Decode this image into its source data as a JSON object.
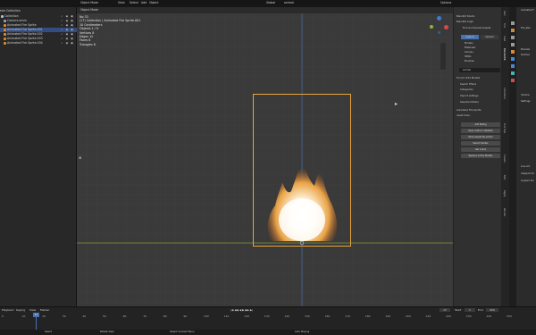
{
  "topbar": {
    "menu": [
      "Object Mode",
      "View",
      "Select",
      "Add",
      "Object"
    ],
    "viewport_menu": [
      "Global",
      "animal"
    ],
    "options": "Options"
  },
  "outliner": {
    "title": "ene Collection",
    "rows": [
      {
        "label": "Collection",
        "indent": 0,
        "selected": false
      },
      {
        "label": "Camera.amm",
        "indent": 1,
        "selected": false
      },
      {
        "label": "Animated Fire Sprite",
        "indent": 1,
        "selected": false
      },
      {
        "label": "Animated Fire Sprite.001",
        "indent": 1,
        "selected": true
      },
      {
        "label": "Animated Fire Sprite.002",
        "indent": 1,
        "selected": false
      },
      {
        "label": "Animated Fire Sprite.003",
        "indent": 1,
        "selected": false
      },
      {
        "label": "Animated Fire Sprite.004",
        "indent": 1,
        "selected": false
      }
    ]
  },
  "viewport": {
    "header_left": "Object Mode",
    "stats": [
      "No 33",
      "(17) Collection | Animated Fire Sprite.001",
      "10 Centimeters",
      "",
      "Objects   1 / 9",
      "Vertices   8",
      "Edges   12",
      "Faces   6",
      "Triangles   8"
    ]
  },
  "side_panel": {
    "header": "Blendkit Studio",
    "items": [
      "Blendkit Studio",
      "Blendkit Login",
      "Find and Upload Assets"
    ],
    "tabs": [
      "Search",
      "Upload"
    ],
    "categories": [
      "Models",
      "Materials",
      "Scenes",
      "HDRs",
      "Brushes"
    ],
    "search_value": "animal",
    "found": "Found 1234 Models",
    "sections": [
      "Search Filters",
      "Categories",
      "Import settings",
      "Selected Model"
    ],
    "model_name": "Animated Fire Sprite",
    "asset_tools": "Asset tools:",
    "buttons": [
      "Add Rating",
      "Open Author's Website",
      "Show Assets By Author",
      "Search Similar",
      "Get online",
      "Replace Active Models"
    ]
  },
  "vertical_tabs": [
    "Item",
    "Tool",
    "View",
    "BlenderKit",
    "Animation",
    "Tool Tips",
    "Create",
    "Edit",
    "Rigify",
    "Render"
  ],
  "properties": {
    "title": "Animated F",
    "sub": "Fire_Ren",
    "rows": [
      "Preview",
      "Surface",
      "Volume",
      "Settings",
      "Line Art",
      "Viewport Di",
      "Custom Pro"
    ]
  },
  "timeline": {
    "menu": [
      "Playback",
      "Keying",
      "View",
      "Marker"
    ],
    "current_frame": "17",
    "start": "Start",
    "start_val": "1",
    "end": "End",
    "end_val": "250",
    "ticks": [
      "0",
      "10",
      "20",
      "30",
      "40",
      "50",
      "60",
      "70",
      "80",
      "90",
      "100",
      "110",
      "120",
      "130",
      "140",
      "150",
      "160",
      "170",
      "180",
      "190",
      "200",
      "210",
      "220",
      "230",
      "240",
      "250"
    ]
  },
  "statusbar": {
    "items": [
      "Select",
      "Rotate View",
      "Object Context Menu",
      "Auto Playing"
    ]
  }
}
